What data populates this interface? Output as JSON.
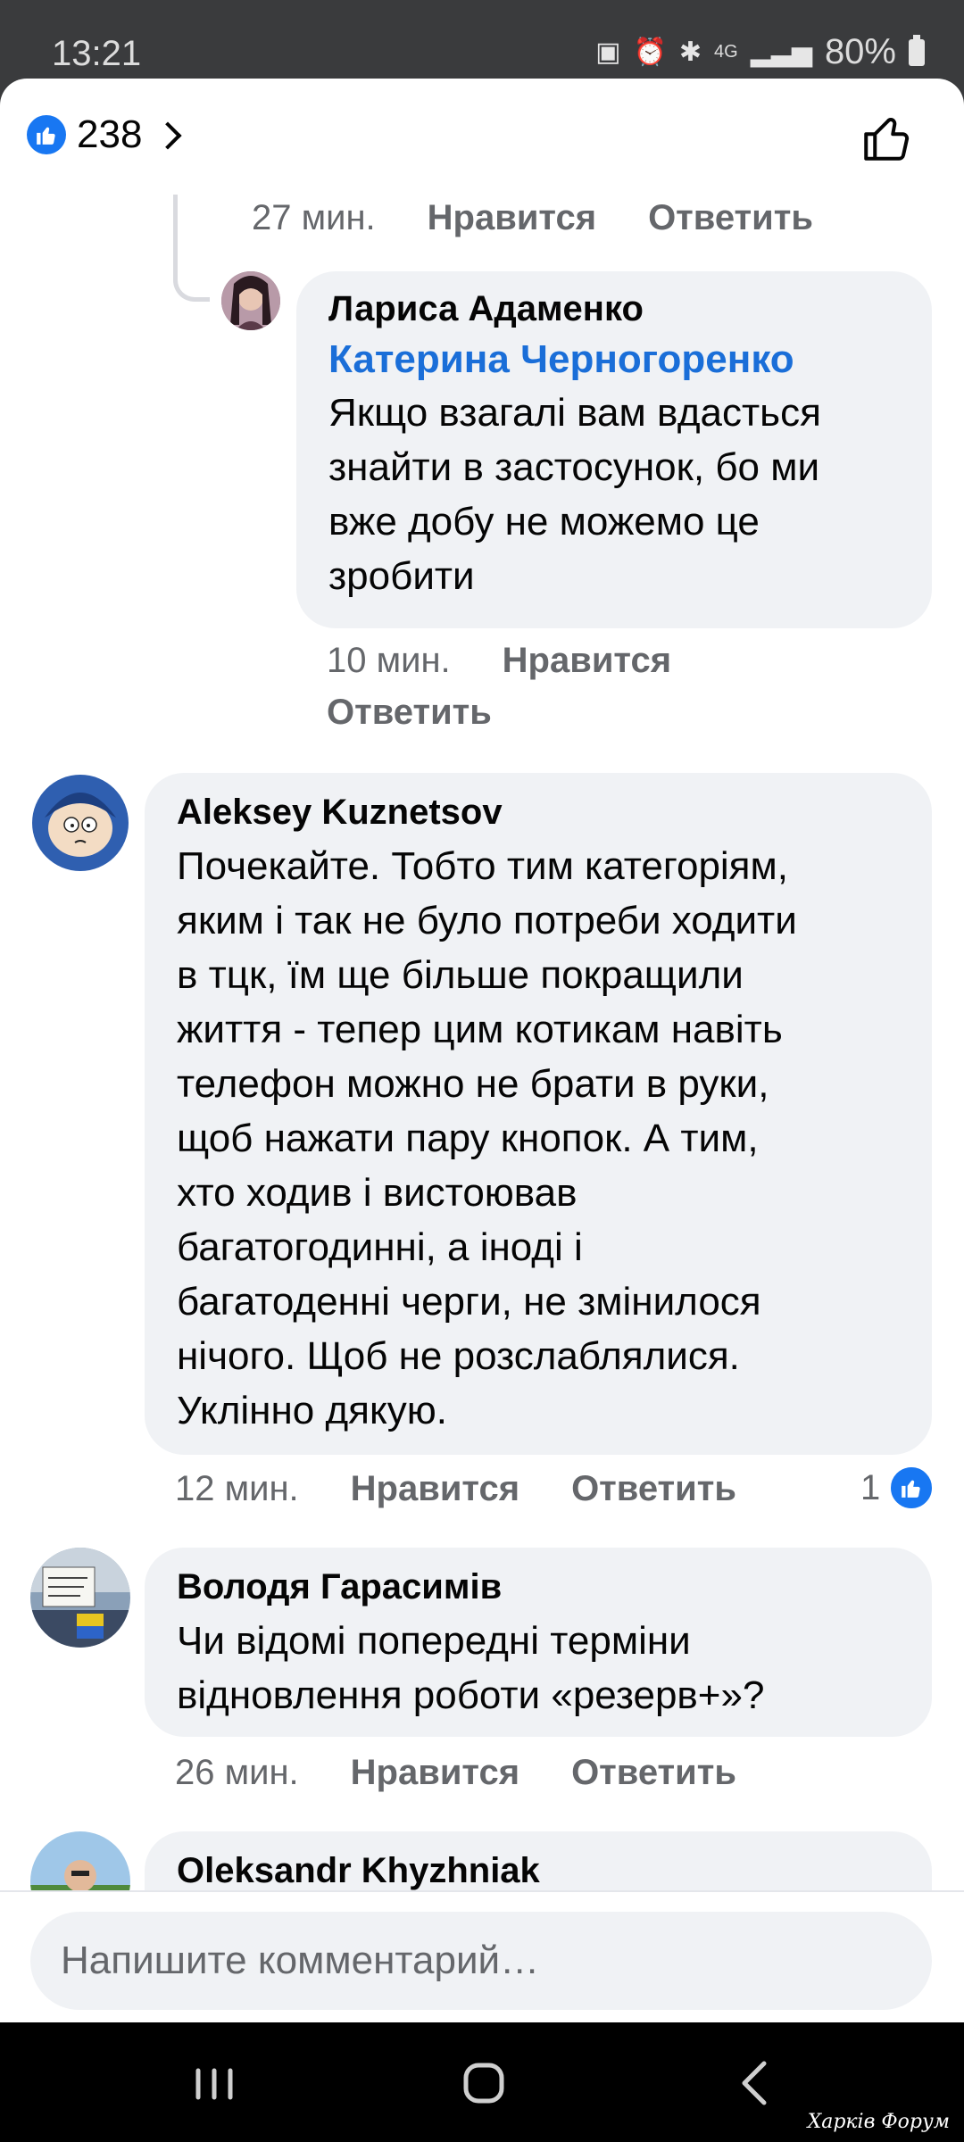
{
  "status_bar": {
    "time": "13:21",
    "network": "4G",
    "battery": "80%"
  },
  "header": {
    "reaction_count": "238"
  },
  "comments": [
    {
      "meta": {
        "time": "27 мин.",
        "like": "Нравится",
        "reply": "Ответить"
      }
    },
    {
      "author": "Лариса Адаменко",
      "mention": "Катерина Черногоренко",
      "lines": [
        "Якщо взагалі вам вдасться",
        "знайти в застосунок, бо ми",
        "вже добу не можемо це",
        "зробити"
      ],
      "meta": {
        "time": "10 мин.",
        "like": "Нравится",
        "reply": "Ответить"
      }
    },
    {
      "author": "Aleksey Kuznetsov",
      "lines": [
        "Почекайте. Тобто тим категоріям,",
        "яким і так не було потреби ходити",
        "в тцк, їм ще більше покращили",
        "життя - тепер цим котикам навіть",
        "телефон можно не брати в руки,",
        "щоб нажати пару кнопок. А тим,",
        "хто ходив і вистоював",
        "багатогодинні, а іноді і",
        "багатоденні черги, не змінилося",
        "нічого. Щоб не розслаблялися.",
        "Уклінно дякую."
      ],
      "meta": {
        "time": "12 мин.",
        "like": "Нравится",
        "reply": "Ответить"
      },
      "reactions": "1"
    },
    {
      "author": "Володя Гарасимів",
      "lines": [
        "Чи відомі попередні терміни",
        "відновлення роботи «резерв+»?"
      ],
      "meta": {
        "time": "26 мин.",
        "like": "Нравится",
        "reply": "Ответить"
      }
    },
    {
      "author": "Oleksandr Khyzhniak"
    }
  ],
  "composer": {
    "placeholder": "Напишите комментарий…"
  },
  "watermark": "Харків Форум",
  "colors": {
    "accent": "#1877f2",
    "bubble": "#f0f2f5",
    "muted": "#65676b"
  }
}
